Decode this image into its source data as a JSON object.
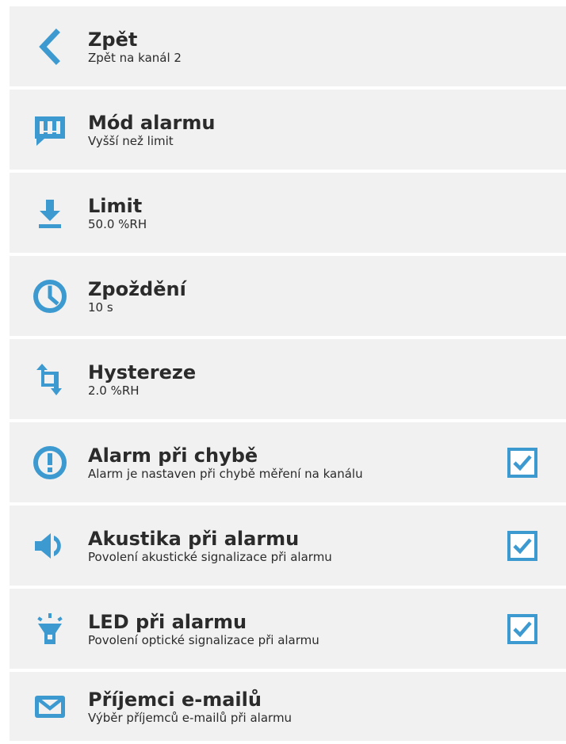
{
  "accent_color": "#3d9ad1",
  "items": [
    {
      "icon": "chevron-left-icon",
      "title": "Zpět",
      "subtitle": "Zpět na kanál 2"
    },
    {
      "icon": "alarm-bubble-icon",
      "title": "Mód alarmu",
      "subtitle": "Vyšší než limit"
    },
    {
      "icon": "download-limit-icon",
      "title": "Limit",
      "subtitle": "50.0 %RH"
    },
    {
      "icon": "clock-icon",
      "title": "Zpoždění",
      "subtitle": "10 s"
    },
    {
      "icon": "hysteresis-icon",
      "title": "Hystereze",
      "subtitle": "2.0 %RH"
    },
    {
      "icon": "exclamation-circle-icon",
      "title": "Alarm při chybě",
      "subtitle": "Alarm je nastaven při chybě měření na kanálu",
      "checked": true
    },
    {
      "icon": "speaker-icon",
      "title": "Akustika při alarmu",
      "subtitle": "Povolení akustické signalizace při alarmu",
      "checked": true
    },
    {
      "icon": "led-icon",
      "title": "LED při alarmu",
      "subtitle": "Povolení optické signalizace při alarmu",
      "checked": true
    },
    {
      "icon": "envelope-icon",
      "title": "Příjemci e-mailů",
      "subtitle": "Výběr příjemců e-mailů při alarmu"
    }
  ]
}
